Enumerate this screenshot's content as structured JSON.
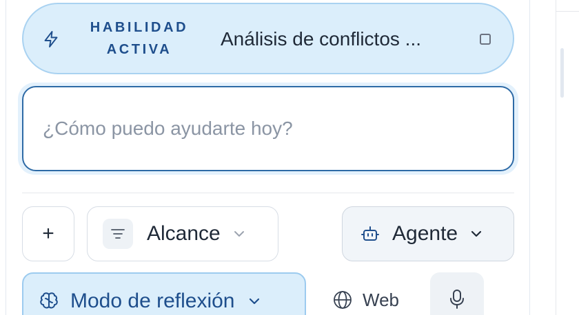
{
  "skill": {
    "label_line1": "HABILIDAD",
    "label_line2": "ACTIVA",
    "name": "Análisis de conflictos ..."
  },
  "input": {
    "placeholder": "¿Cómo puedo ayudarte hoy?",
    "value": ""
  },
  "toolbar": {
    "add_label": "+",
    "scope_label": "Alcance",
    "agent_label": "Agente",
    "mode_label": "Modo de reflexión",
    "web_label": "Web"
  },
  "icons": {
    "skill": "lightning-bolt-icon",
    "skill_action": "square-icon",
    "scope": "filter-icon",
    "agent": "bot-icon",
    "mode": "brain-icon",
    "web": "globe-icon",
    "mic": "microphone-icon",
    "dropdown": "chevron-down-icon"
  },
  "colors": {
    "accent": "#2d6aa6",
    "accent_text": "#1e4e8c",
    "pill_bg": "#dbeefb",
    "pill_border": "#a9d2f1"
  }
}
